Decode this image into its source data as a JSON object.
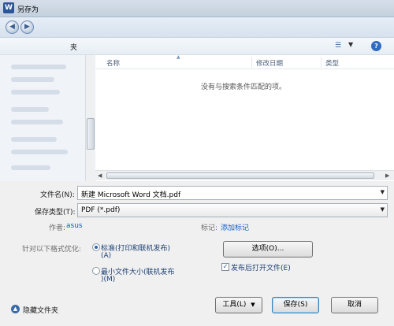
{
  "window": {
    "title": "另存为",
    "app_icon_letter": "W"
  },
  "nav": {
    "back_glyph": "◀",
    "forward_glyph": "▶"
  },
  "toolbar": {
    "folder_label": "夹",
    "view_icon": "list-view-icon",
    "view_caret": "▼",
    "help_glyph": "?"
  },
  "file_list": {
    "columns": [
      "名称",
      "修改日期",
      "类型"
    ],
    "empty_message": "没有与搜索条件匹配的项。"
  },
  "form": {
    "filename_label": "文件名(N):",
    "filename_value": "新建 Microsoft Word 文档.pdf",
    "filetype_label": "保存类型(T):",
    "filetype_value": "PDF (*.pdf)",
    "author_label": "作者:",
    "author_value": "asus",
    "tags_label": "标记:",
    "tags_value": "添加标记",
    "optimize_label": "针对以下格式优化:",
    "option_standard_line1": "标准(打印和联机发布)",
    "option_standard_line2": "(A)",
    "option_minimum_line1": "最小文件大小(联机发布",
    "option_minimum_line2": ")(M)",
    "options_button": "选项(O)...",
    "open_after_publish": "发布后打开文件(E)"
  },
  "footer": {
    "hide_folders": "隐藏文件夹",
    "tools_button": "工具(L)",
    "save_button": "保存(S)",
    "cancel_button": "取消"
  }
}
